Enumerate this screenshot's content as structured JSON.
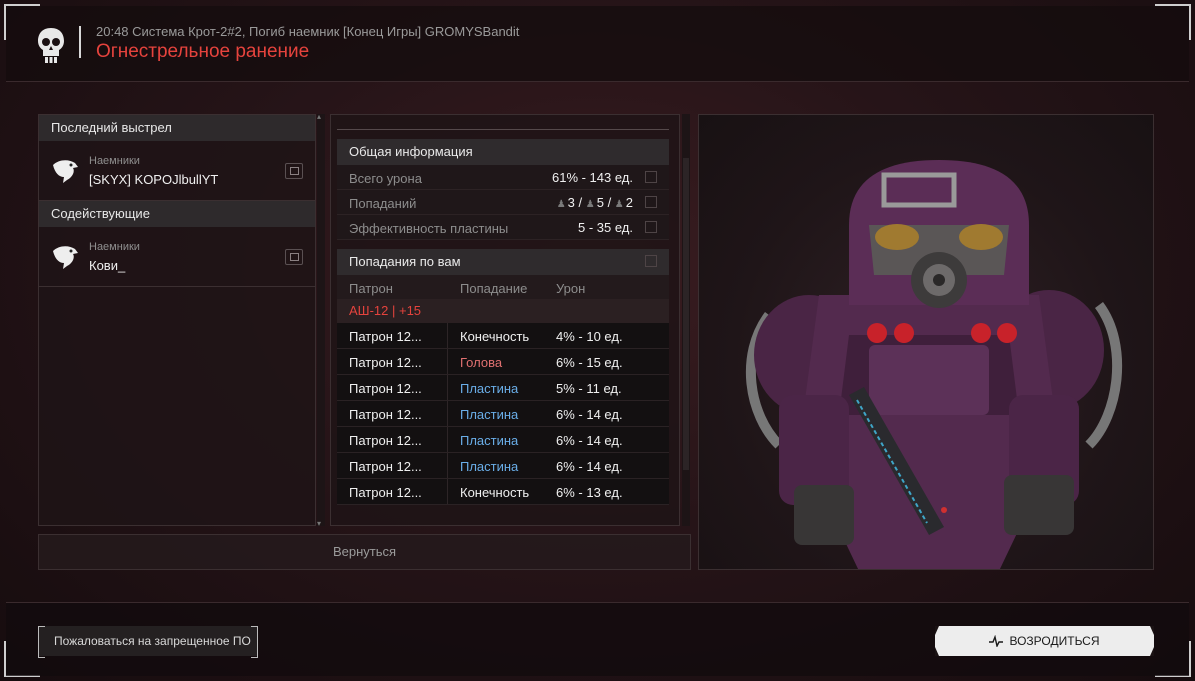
{
  "header": {
    "subtitle": "20:48 Система Крот-2#2, Погиб наемник [Конец Игры] GROMYSBandit",
    "title": "Огнестрельное ранение"
  },
  "left": {
    "last_shot_title": "Последний выстрел",
    "killer": {
      "faction": "Наемники",
      "name": "[SKYX] KOPOJlbullYT"
    },
    "assist_title": "Содействующие",
    "assist": {
      "faction": "Наемники",
      "name": "Кови_"
    }
  },
  "general": {
    "title": "Общая информация",
    "rows": [
      {
        "label": "Всего урона",
        "value": "61% - 143 ед."
      },
      {
        "label": "Попаданий",
        "value": ""
      },
      {
        "label": "Эффективность пластины",
        "value": "5 - 35 ед."
      }
    ],
    "hits_counts": [
      "3",
      "5",
      "2"
    ]
  },
  "hits": {
    "title": "Попадания по вам",
    "headers": [
      "Патрон",
      "Попадание",
      "Урон"
    ],
    "weapon": "АШ-12 | +15",
    "rows": [
      {
        "ammo": "Патрон 12...",
        "part": "Конечность",
        "dmg": "4% - 10 ед.",
        "type": "limb"
      },
      {
        "ammo": "Патрон 12...",
        "part": "Голова",
        "dmg": "6% - 15 ед.",
        "type": "head"
      },
      {
        "ammo": "Патрон 12...",
        "part": "Пластина",
        "dmg": "5% - 11 ед.",
        "type": "plate"
      },
      {
        "ammo": "Патрон 12...",
        "part": "Пластина",
        "dmg": "6% - 14 ед.",
        "type": "plate"
      },
      {
        "ammo": "Патрон 12...",
        "part": "Пластина",
        "dmg": "6% - 14 ед.",
        "type": "plate"
      },
      {
        "ammo": "Патрон 12...",
        "part": "Пластина",
        "dmg": "6% - 14 ед.",
        "type": "plate"
      },
      {
        "ammo": "Патрон 12...",
        "part": "Конечность",
        "dmg": "6% - 13 ед.",
        "type": "limb"
      }
    ]
  },
  "buttons": {
    "back": "Вернуться",
    "report": "Пожаловаться на запрещенное ПО",
    "respawn": "ВОЗРОДИТЬСЯ"
  },
  "colors": {
    "accent_red": "#e5433d",
    "head": "#e07070",
    "plate": "#6aaee8",
    "limb": "#f0f0f0"
  }
}
